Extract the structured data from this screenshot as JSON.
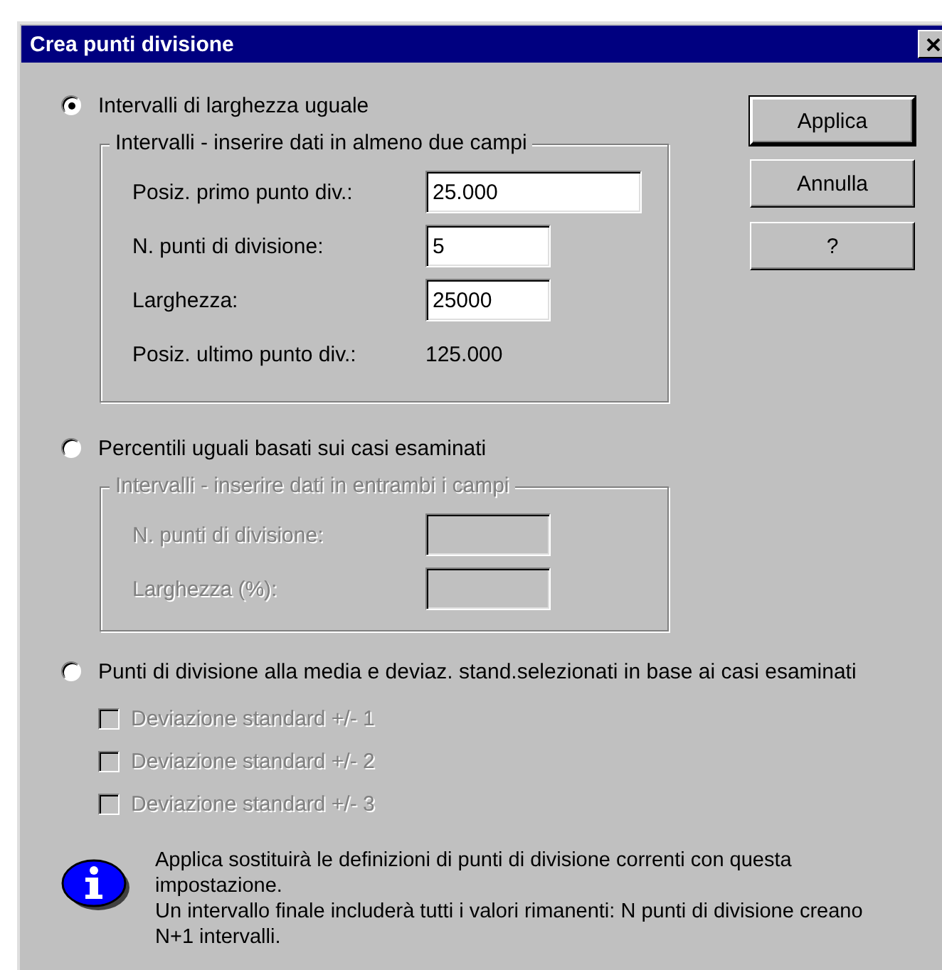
{
  "window": {
    "title": "Crea punti divisione"
  },
  "options": [
    {
      "label": "Intervalli di larghezza uguale",
      "selected": true,
      "group": {
        "title": "Intervalli - inserire dati in almeno due campi",
        "disabled": false,
        "fields": [
          {
            "kind": "input",
            "label": "Posiz. primo punto div.:",
            "value": "25.000",
            "wide": true
          },
          {
            "kind": "input",
            "label": "N. punti di divisione:",
            "value": "5",
            "wide": false
          },
          {
            "kind": "input",
            "label": "Larghezza:",
            "value": "25000",
            "wide": false
          },
          {
            "kind": "readout",
            "label": "Posiz. ultimo punto div.:",
            "value": "125.000"
          }
        ]
      }
    },
    {
      "label": "Percentili uguali basati sui casi esaminati",
      "selected": false,
      "group": {
        "title": "Intervalli - inserire dati in entrambi i campi",
        "disabled": true,
        "fields": [
          {
            "kind": "input",
            "label": "N. punti di divisione:",
            "wide": false
          },
          {
            "kind": "input",
            "label": "Larghezza (%):",
            "wide": false
          }
        ]
      }
    },
    {
      "label": "Punti di divisione alla media e deviaz. stand.selezionati in base ai casi esaminati",
      "selected": false,
      "checks": [
        {
          "label": "Deviazione standard +/- 1",
          "checked": false,
          "disabled": true
        },
        {
          "label": "Deviazione standard +/- 2",
          "checked": false,
          "disabled": true
        },
        {
          "label": "Deviazione standard +/- 3",
          "checked": false,
          "disabled": true
        }
      ]
    }
  ],
  "buttons": [
    {
      "label": "Applica",
      "default": true
    },
    {
      "label": "Annulla",
      "default": false
    },
    {
      "label": "?",
      "default": false
    }
  ],
  "info": {
    "lines": [
      "Applica sostituirà le definizioni di punti di divisione correnti con questa impostazione.",
      "Un intervallo finale includerà tutti i valori rimanenti: N punti di divisione creano N+1 intervalli."
    ]
  }
}
